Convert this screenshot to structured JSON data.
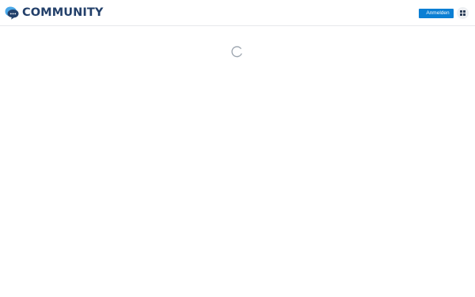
{
  "header": {
    "logo_text": "COMMUNITY",
    "login_label": "Anmelden",
    "apps_icon": "apps-grid-icon",
    "logo_icon": "chat-bubbles-icon"
  },
  "main": {
    "loading_icon": "loading-spinner-icon"
  },
  "colors": {
    "brand": "#23406a",
    "accent": "#0b7fd4",
    "logo_bubble": "#2a8fd6"
  }
}
